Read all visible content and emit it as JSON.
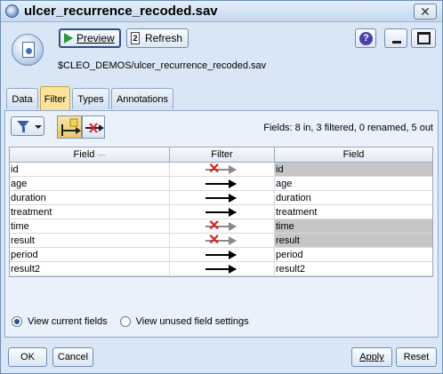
{
  "window": {
    "title": "ulcer_recurrence_recoded.sav",
    "close_glyph": "✕"
  },
  "toolbar": {
    "preview_label": "Preview",
    "refresh_label": "Refresh",
    "refresh_glyph": "2",
    "help_glyph": "?"
  },
  "file_path": "$CLEO_DEMOS/ulcer_recurrence_recoded.sav",
  "tabs": [
    {
      "label": "Data",
      "active": false
    },
    {
      "label": "Filter",
      "active": true
    },
    {
      "label": "Types",
      "active": false
    },
    {
      "label": "Annotations",
      "active": false
    }
  ],
  "summary": "Fields: 8 in, 3 filtered, 0 renamed, 5 out",
  "table": {
    "columns": [
      "Field",
      "Filter",
      "Field"
    ],
    "field_sort_indicator": "—",
    "rows": [
      {
        "field": "id",
        "filtered": true,
        "out": "id"
      },
      {
        "field": "age",
        "filtered": false,
        "out": "age"
      },
      {
        "field": "duration",
        "filtered": false,
        "out": "duration"
      },
      {
        "field": "treatment",
        "filtered": false,
        "out": "treatment"
      },
      {
        "field": "time",
        "filtered": true,
        "out": "time"
      },
      {
        "field": "result",
        "filtered": true,
        "out": "result"
      },
      {
        "field": "period",
        "filtered": false,
        "out": "period"
      },
      {
        "field": "result2",
        "filtered": false,
        "out": "result2"
      }
    ]
  },
  "options": {
    "view_current": "View current fields",
    "view_unused": "View unused field settings",
    "selected": "view_current"
  },
  "buttons": {
    "ok": "OK",
    "cancel": "Cancel",
    "apply": "Apply",
    "reset": "Reset"
  },
  "colors": {
    "filtered_cell": "#c6c6c6",
    "x_mark": "#e02020",
    "active_tab": "#fbe39a"
  },
  "icons": {
    "title": "stream-node-icon",
    "node": "statistics-file-icon",
    "filter_menu": "funnel-icon",
    "tool_rename": "rename-tool-icon",
    "tool_filter": "filter-toggle-icon"
  }
}
